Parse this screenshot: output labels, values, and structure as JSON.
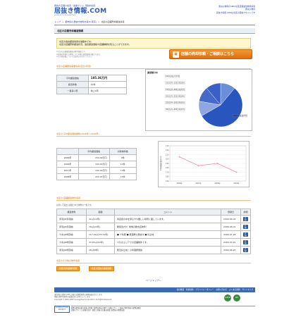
{
  "header": {
    "tagline": "居抜き店舗の検索・開業サイト【居抜情報】",
    "logo": "居抜き情報.COM",
    "logo_sub": "powered by SynergyFood",
    "link1": "豊洲沙物件のSMIC北区店舗譲渡物件情報",
    "link2": "豊洲沙物件",
    "link3": "居抜き情報.COMは北区の居抜きサイトです"
  },
  "breadcrumb": {
    "items": [
      "トップ",
      "都市別に居抜き物件を探す(東京)",
      "北区の店舗売却譲渡情報"
    ],
    "separator": ">"
  },
  "page_title": "北区の店舗売却譲渡情報",
  "intro": {
    "line1": "北区の過去譲渡情報を掲載中です。",
    "line2": "北区の店舗売却譲渡状況、過去譲渡価格や店舗種類を知ることができます。"
  },
  "notes": [
    "※下記の店舗譲渡価格は参考価格です。",
    "※店舗の状態や立地等により実際の譲渡価格は異なります。",
    "※その他詳細についてはお問い合わせください。"
  ],
  "cta_button": "店舗の売却依頼・ご相談はこちら",
  "section1": {
    "title": "北区の店舗譲渡事業情報(直近1年間)"
  },
  "stats": {
    "rows": [
      {
        "label": "平均譲渡価格",
        "value": "185.36万円"
      },
      {
        "label": "該当件数",
        "value": "14件"
      },
      {
        "label": "一番多い階",
        "value": "地上1階"
      }
    ]
  },
  "pie": {
    "title": "譲渡額分布"
  },
  "section2": {
    "title": "北区の 平均譲渡価格推移(2006年〜2009年)"
  },
  "yearly": {
    "headers": [
      "",
      "平均譲渡価格",
      "対象物件数"
    ],
    "rows": [
      {
        "year": "2006年",
        "price": "159.00万円",
        "count": "9件"
      },
      {
        "year": "2006年",
        "price": "190.00万円",
        "count": "14件"
      },
      {
        "year": "2007年",
        "price": "190.00万円",
        "count": "13件"
      },
      {
        "year": "2008年",
        "price": "220.47万円",
        "count": "15件"
      }
    ]
  },
  "section3": {
    "title": "北区の 店舗譲渡物件情報"
  },
  "listing_note": "北区にて過去に譲渡された物件の一覧です。",
  "listings": {
    "headers": [
      "譲渡物件",
      "面積",
      "コメント",
      "登録日",
      "詳細"
    ],
    "rows": [
      {
        "name": "赤羽(JR赤羽線)",
        "area": "42㎡(12坪)",
        "comment": "商店街の中を通るやや難しい場所に面しています。",
        "date": "2009-06-04",
        "detail": "詳細"
      },
      {
        "name": "赤羽(JR赤羽線)",
        "area": "76㎡(23坪)",
        "comment": "駅徒歩2分！地域の飲食店物件！",
        "date": "2008-08-01",
        "detail": "詳細"
      },
      {
        "name": "十条(JR埼京線)",
        "area": "117.09㎡(35.51坪)",
        "comment": "■ 十条駅 ■ 居酒屋の居抜き ■ 好立地",
        "date": "2009-07-28",
        "detail": "詳細"
      },
      {
        "name": "十条(JR埼京線)",
        "area": "33.05㎡(10坪)",
        "comment": "人気のエリアでの店舗物件です。",
        "date": "2009-07-22",
        "detail": "詳細"
      },
      {
        "name": "赤羽(JR埼京線)",
        "area": "26㎡(8坪)",
        "comment": "駅近好立地・小料理屋居抜",
        "date": "2009-06-25",
        "detail": "詳細"
      }
    ]
  },
  "section4": {
    "title": "北区のその他の物件情報"
  },
  "other_buttons": [
    "北区の新着物件情報",
    "北区の居抜き物件情報"
  ],
  "pagetop": "ページトップへ",
  "footnav": [
    "会社概要",
    "利用規約",
    "プライバシーポリシー",
    "お問い合わせ",
    "よくある質問",
    "サイトマップ"
  ],
  "footinfo": {
    "line1": "(株)居抜き情報.COMに記載の店舗情報等の無断転載を禁止します。",
    "line2": "掲載の物件情報等の転載は固くお断りいたします。",
    "line3": "Copyright © 2007-2009 SynergyFood Corporation. All Rights Reserved."
  },
  "footer_badges": [
    "JAPAN",
    "ISO"
  ],
  "synergy": "SYNERGYFOOD PROJECT",
  "footlinks": {
    "line1": "飲食店開業支援の居抜き情報 | 飲食店居抜き物件 | 店舗デザイン | 居抜き物件情報 | 飲食店開業",
    "line2": "店舗デザイン | 店舗の売却・譲渡 | 居抜き店舗の相談 | 飲食店の開業支援"
  },
  "chart_data": [
    {
      "type": "pie",
      "title": "譲渡額分布",
      "series": [
        {
          "values": [
            {
              "label": "100万円以下(1件)",
              "value": 1
            },
            {
              "label": "100万円〜150万円(5件)",
              "value": 5
            },
            {
              "label": "150万円〜200万円(1件)",
              "value": 1
            },
            {
              "label": "200万円〜250万円(0件)",
              "value": 0
            },
            {
              "label": "250万円〜300万円(1件)",
              "value": 1
            },
            {
              "label": "300万円〜400万円(1件)",
              "value": 1
            },
            {
              "label": "200万円未満(0件)",
              "value": 0
            }
          ]
        }
      ],
      "colors": [
        "#6b8fd6",
        "#2955bf",
        "#8ea7e2",
        "#c0cff0",
        "#4669c9",
        "#3a5fc6",
        "#1e3f9c"
      ]
    },
    {
      "type": "line",
      "x": [
        "2006年",
        "2007年",
        "2008年",
        "2009年"
      ],
      "series": [
        {
          "values": [
            205,
            185,
            190,
            170
          ]
        }
      ],
      "ylim": [
        150,
        230
      ],
      "yticks": [
        150,
        160,
        170,
        180,
        190,
        200,
        210,
        220,
        230
      ],
      "ylabel": "平均譲渡価格(万円)",
      "color": "#e88aa0",
      "grid": true
    }
  ]
}
